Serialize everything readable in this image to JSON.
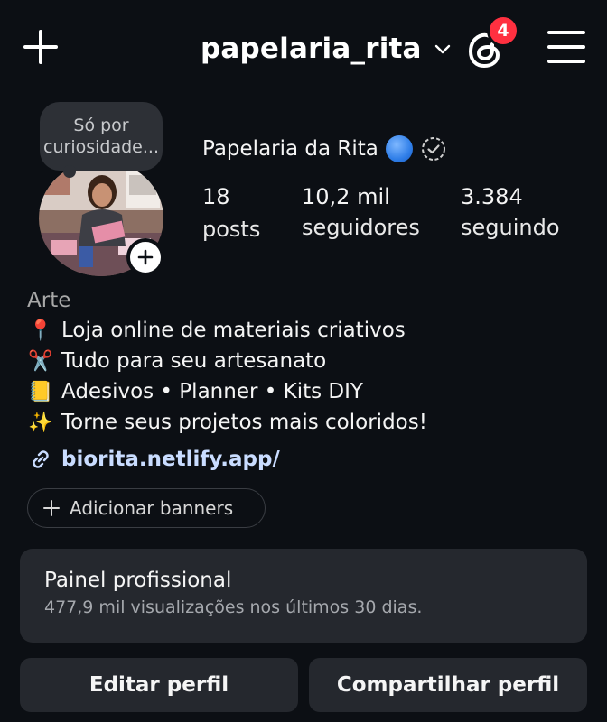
{
  "header": {
    "username": "papelaria_rita",
    "notification_count": "4"
  },
  "profile": {
    "note": "Só por curiosidade...",
    "display_name": "Papelaria da Rita",
    "stats": [
      {
        "value": "18",
        "label": "posts"
      },
      {
        "value": "10,2 mil",
        "label": "seguidores"
      },
      {
        "value": "3.384",
        "label": "seguindo"
      }
    ]
  },
  "bio": {
    "category": "Arte",
    "lines": [
      {
        "emoji": "📍",
        "text": "Loja online de materiais criativos"
      },
      {
        "emoji": "✂️",
        "text": "Tudo para seu artesanato"
      },
      {
        "emoji": "📒",
        "text": "Adesivos • Planner • Kits DIY"
      },
      {
        "emoji": "✨",
        "text": "Torne seus projetos mais coloridos!"
      }
    ],
    "link": "biorita.netlify.app/"
  },
  "actions": {
    "add_banners": "Adicionar banners",
    "edit_profile": "Editar perfil",
    "share_profile": "Compartilhar perfil"
  },
  "dashboard": {
    "title": "Painel profissional",
    "subtitle": "477,9 mil visualizações nos últimos 30 dias."
  },
  "colors": {
    "background": "#0c0f14",
    "badge": "#ff3040",
    "panel": "#25282e",
    "link": "#c9dcff"
  }
}
